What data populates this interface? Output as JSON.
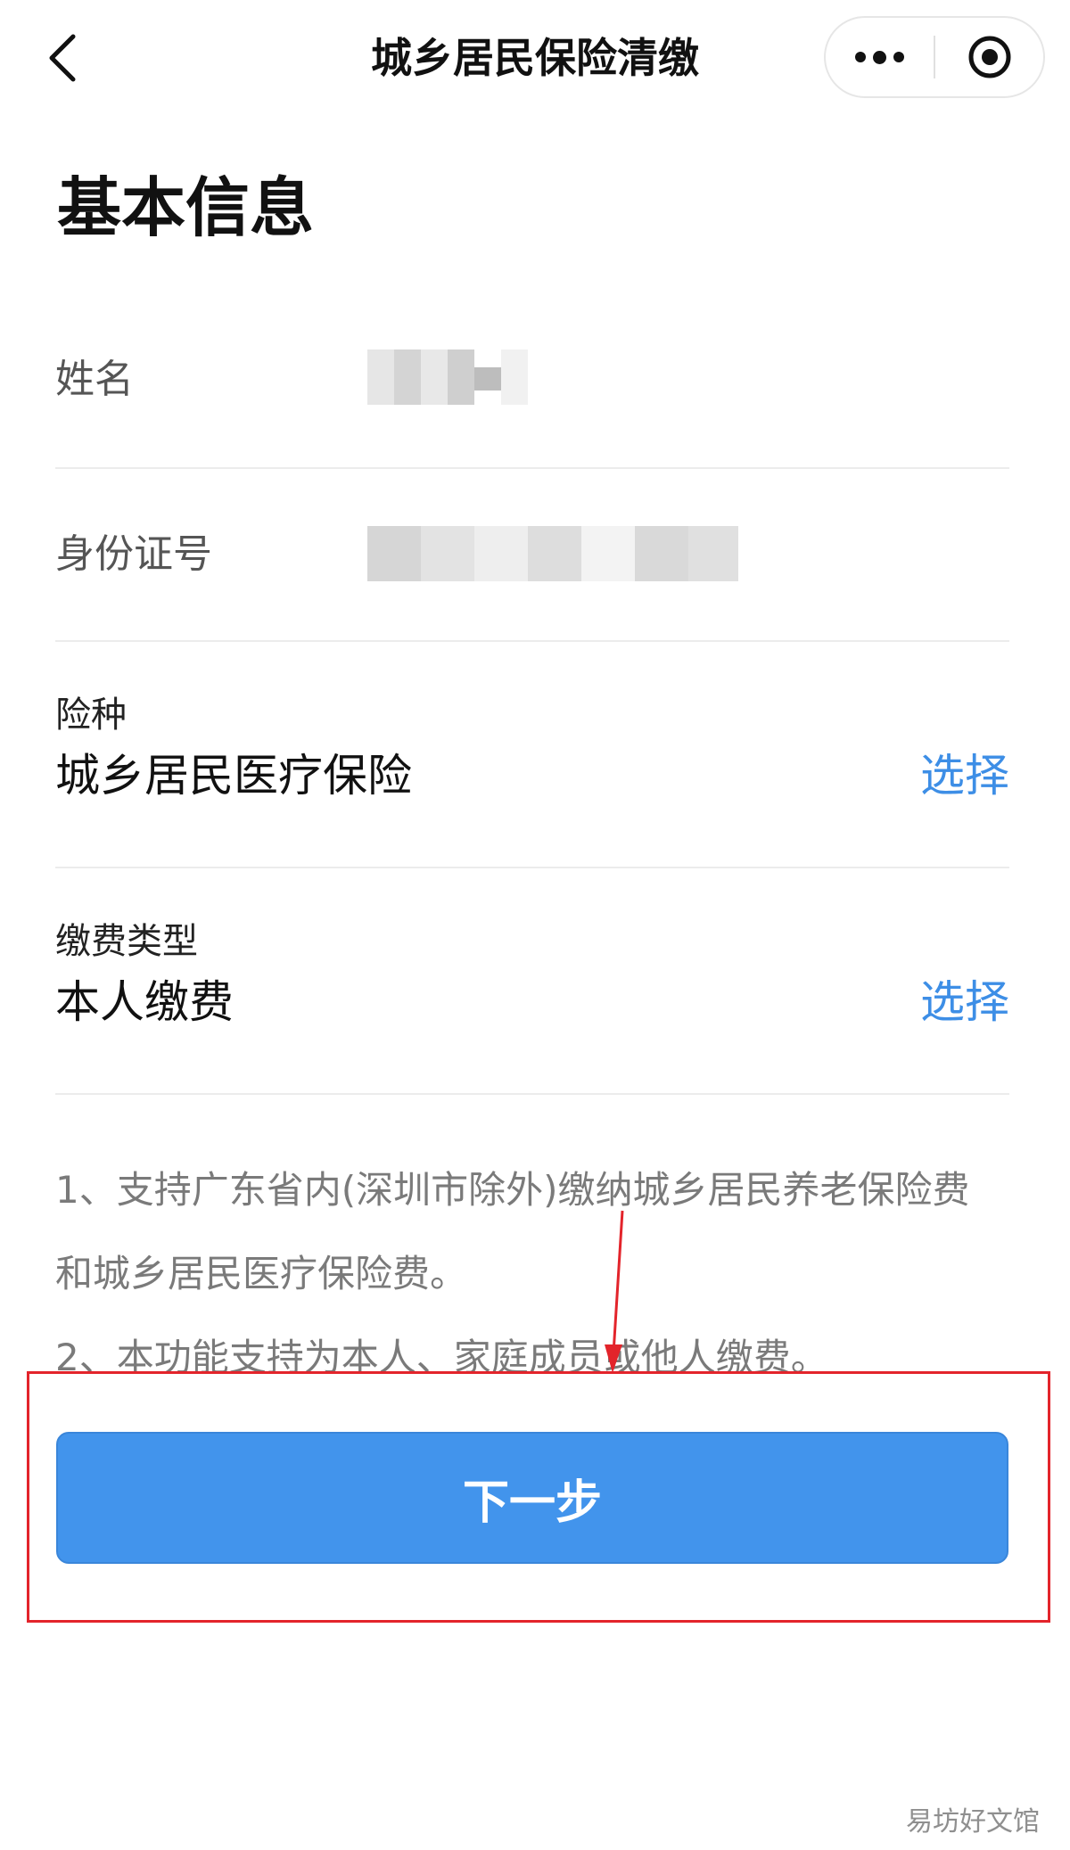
{
  "nav": {
    "title": "城乡居民保险清缴",
    "back_icon": "chevron-left-icon",
    "more_icon": "more-dots-icon",
    "close_icon": "target-circle-icon"
  },
  "section": {
    "title": "基本信息"
  },
  "form": {
    "name_label": "姓名",
    "id_label": "身份证号",
    "insurance": {
      "label": "险种",
      "value": "城乡居民医疗保险",
      "action": "选择"
    },
    "payment_type": {
      "label": "缴费类型",
      "value": "本人缴费",
      "action": "选择"
    }
  },
  "notes": [
    "1、支持广东省内(深圳市除外)缴纳城乡居民养老保险费和城乡居民医疗保险费。",
    "2、本功能支持为本人、家庭成员或他人缴费。"
  ],
  "buttons": {
    "next": "下一步"
  },
  "watermark": "易坊好文馆",
  "colors": {
    "accent": "#4294ec",
    "link": "#3d8ee6",
    "highlight": "#e3242b"
  }
}
